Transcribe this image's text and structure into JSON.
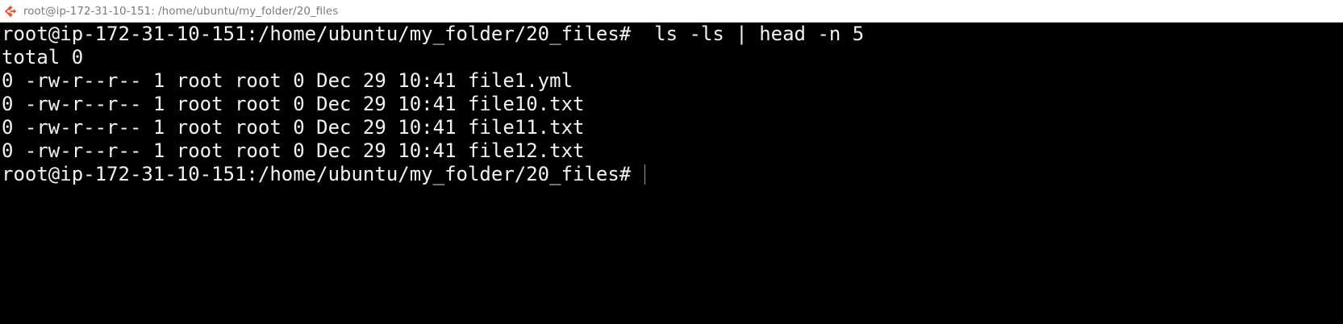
{
  "window": {
    "title": "root@ip-172-31-10-151: /home/ubuntu/my_folder/20_files",
    "icon": "git-bash-icon"
  },
  "terminal": {
    "lines": [
      "root@ip-172-31-10-151:/home/ubuntu/my_folder/20_files#  ls -ls | head -n 5",
      "total 0",
      "0 -rw-r--r-- 1 root root 0 Dec 29 10:41 file1.yml",
      "0 -rw-r--r-- 1 root root 0 Dec 29 10:41 file10.txt",
      "0 -rw-r--r-- 1 root root 0 Dec 29 10:41 file11.txt",
      "0 -rw-r--r-- 1 root root 0 Dec 29 10:41 file12.txt"
    ],
    "prompt": "root@ip-172-31-10-151:/home/ubuntu/my_folder/20_files# "
  },
  "colors": {
    "background": "#000000",
    "foreground": "#f2f2f2",
    "titlebar": "#ffffff",
    "title_text": "#7a7a7a"
  }
}
